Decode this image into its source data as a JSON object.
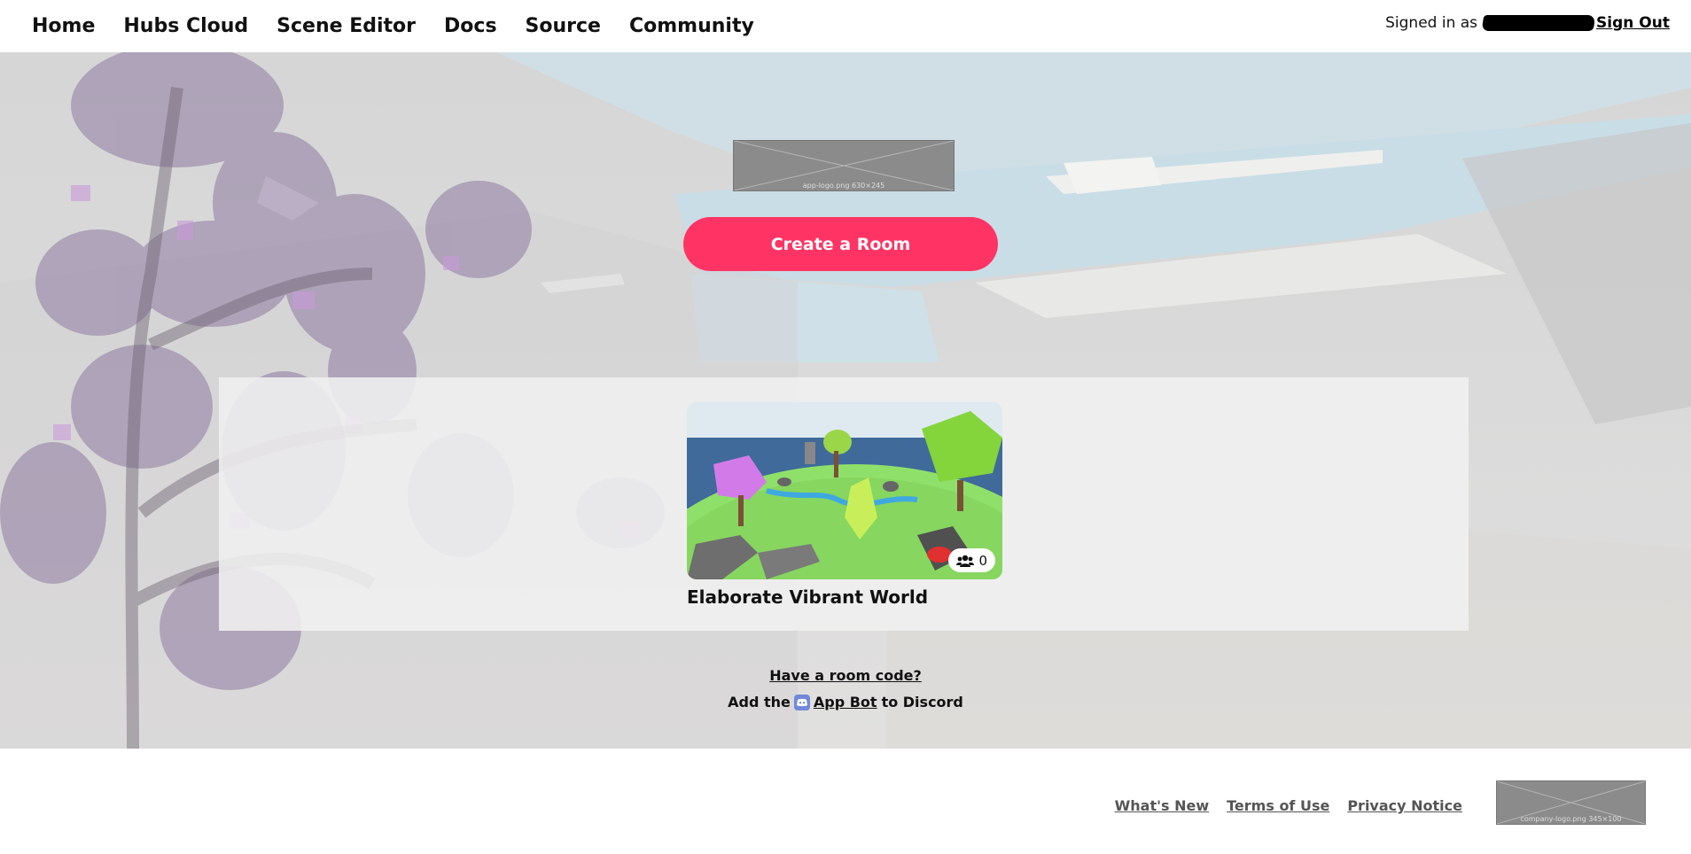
{
  "nav": {
    "items": [
      {
        "label": "Home"
      },
      {
        "label": "Hubs Cloud"
      },
      {
        "label": "Scene Editor"
      },
      {
        "label": "Docs"
      },
      {
        "label": "Source"
      },
      {
        "label": "Community"
      }
    ],
    "signed_in_prefix": "Signed in as",
    "sign_out": "Sign Out"
  },
  "hero": {
    "logo_caption": "app-logo.png 630×245",
    "create_room": "Create a Room"
  },
  "rooms": [
    {
      "name": "Elaborate Vibrant World",
      "member_count": "0",
      "icon": "users-icon"
    }
  ],
  "links": {
    "room_code": "Have a room code?",
    "discord_prefix": "Add the",
    "discord_bot": "App Bot",
    "discord_suffix": "to Discord",
    "discord_icon": "discord-icon"
  },
  "footer": {
    "links": [
      {
        "label": "What's New"
      },
      {
        "label": "Terms of Use"
      },
      {
        "label": "Privacy Notice"
      }
    ],
    "company_caption": "company-logo.png 345×100"
  },
  "colors": {
    "accent": "#ff3464",
    "discord": "#7289da"
  }
}
